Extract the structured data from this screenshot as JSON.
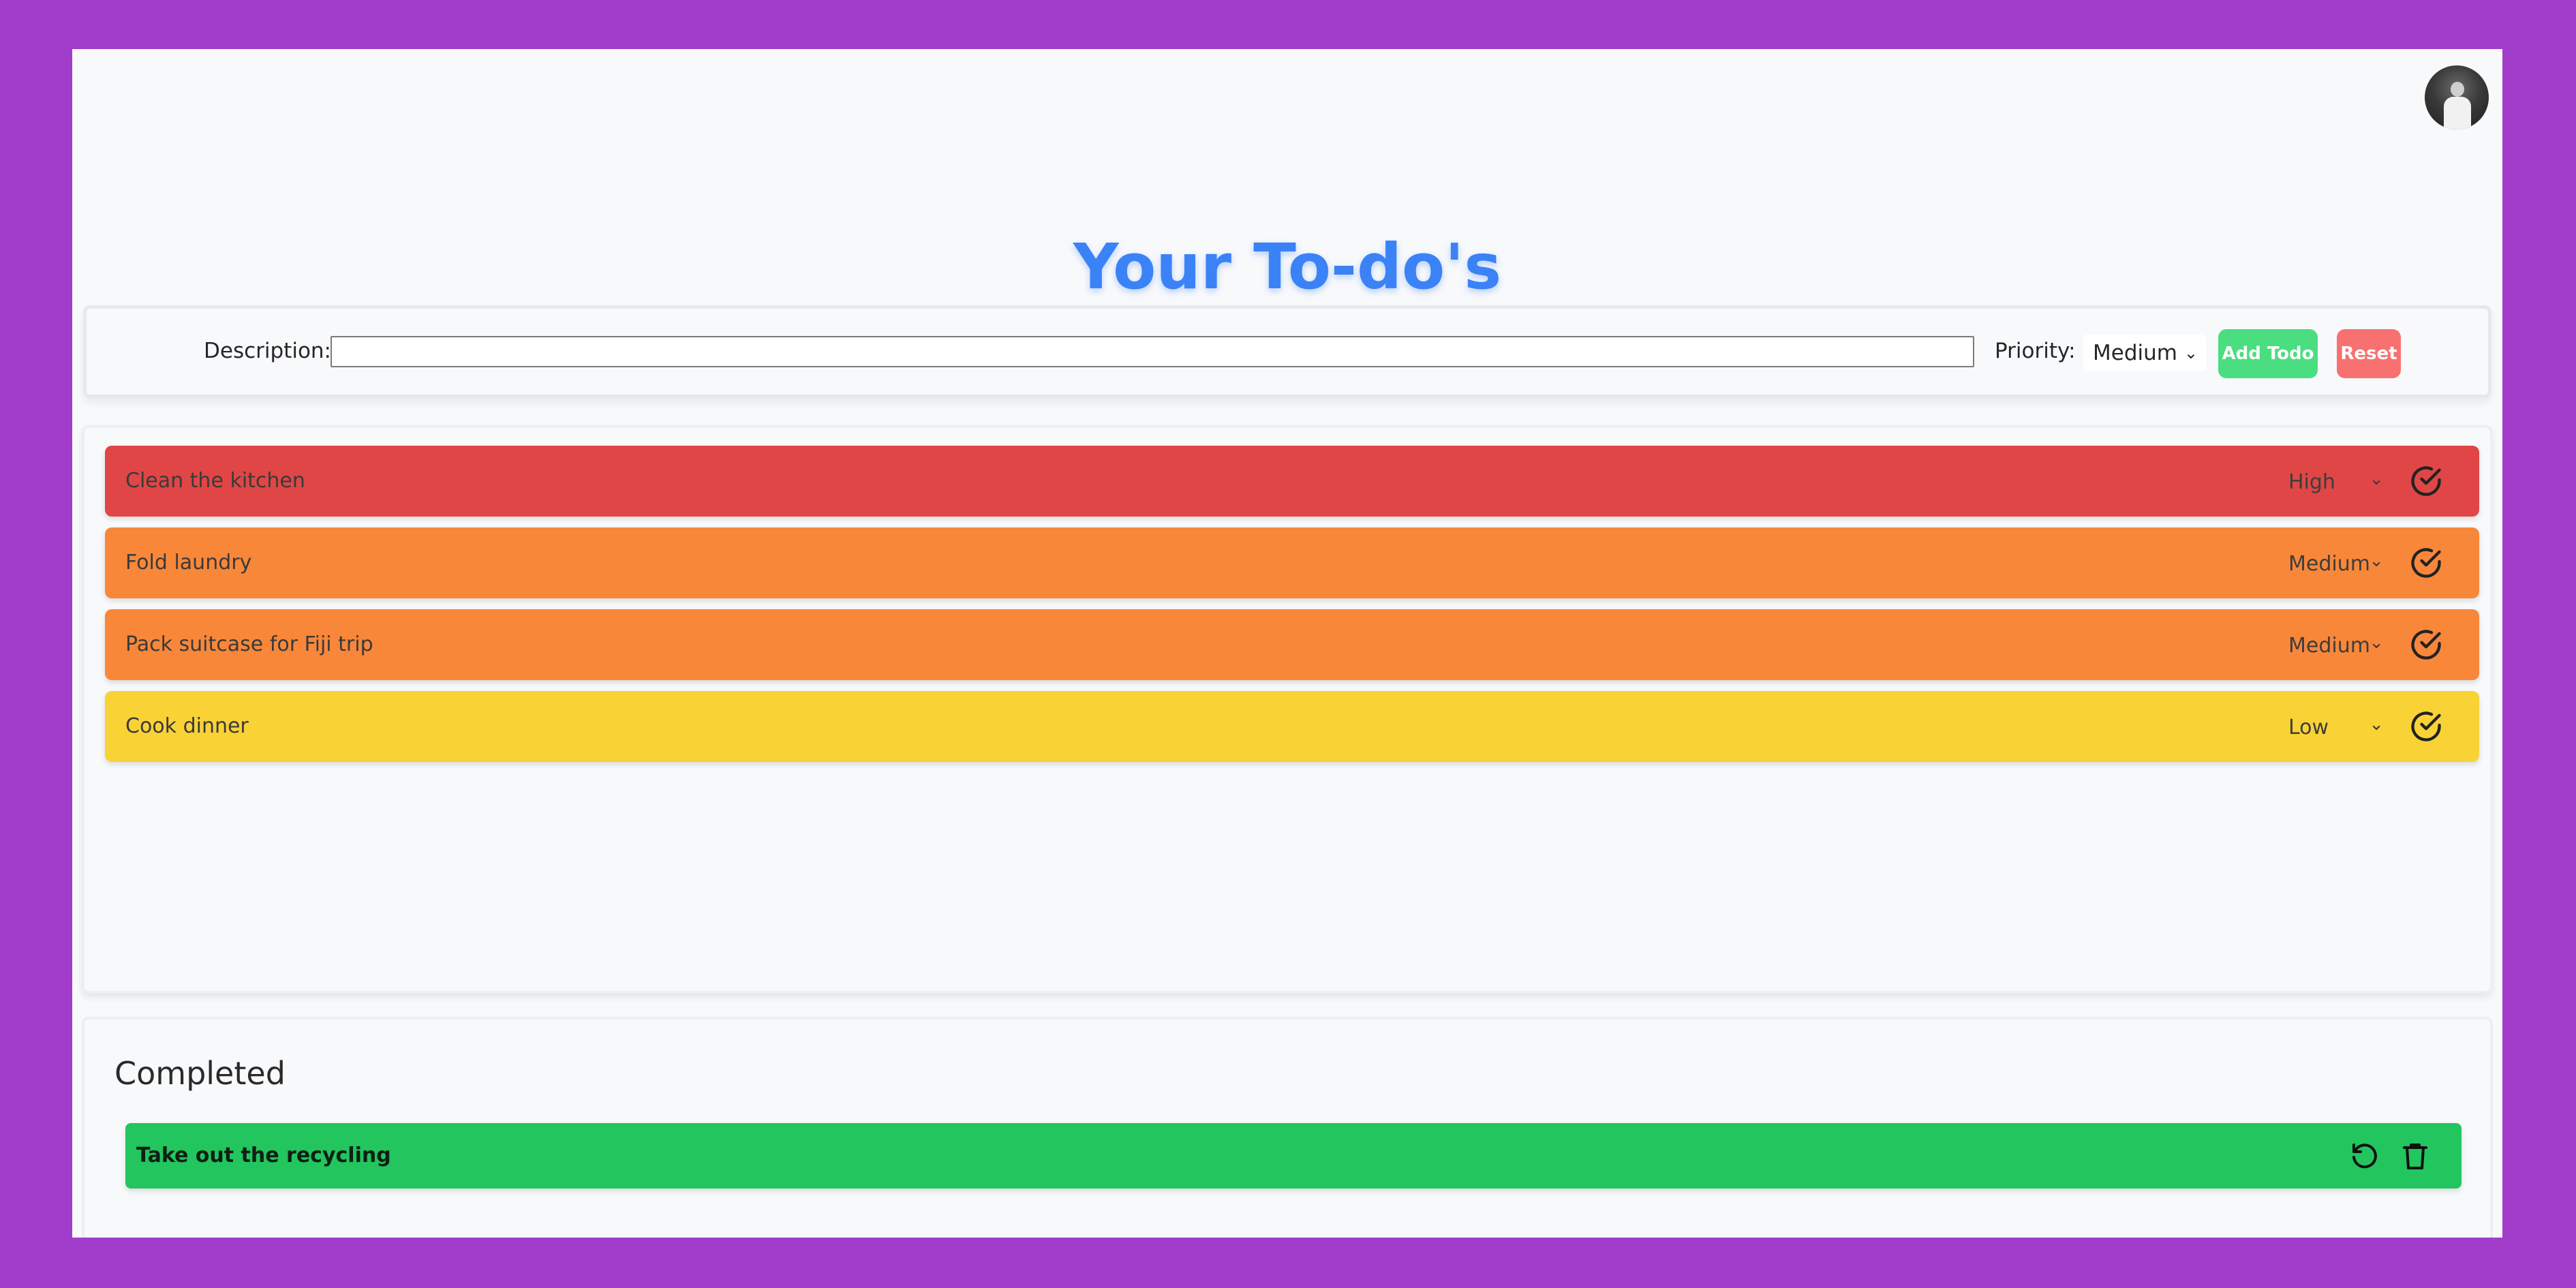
{
  "header": {
    "title": "Your To-do's",
    "avatar": "user-avatar"
  },
  "form": {
    "description_label": "Description:",
    "description_value": "",
    "priority_label": "Priority:",
    "priority_selected": "Medium",
    "add_label": "Add Todo",
    "reset_label": "Reset"
  },
  "todos": [
    {
      "text": "Clean the kitchen",
      "priority": "High",
      "color": "#e04646"
    },
    {
      "text": "Fold laundry",
      "priority": "Medium",
      "color": "#f8873a"
    },
    {
      "text": "Pack suitcase for Fiji trip",
      "priority": "Medium",
      "color": "#f8873a"
    },
    {
      "text": "Cook dinner",
      "priority": "Low",
      "color": "#f9d236"
    }
  ],
  "completed": {
    "title": "Completed",
    "items": [
      {
        "text": "Take out the recycling"
      }
    ]
  },
  "colors": {
    "background": "#a23ccb",
    "accent": "#3b82f6",
    "add_button": "#4ade80",
    "reset_button": "#f87171",
    "completed_item": "#22c55e"
  }
}
